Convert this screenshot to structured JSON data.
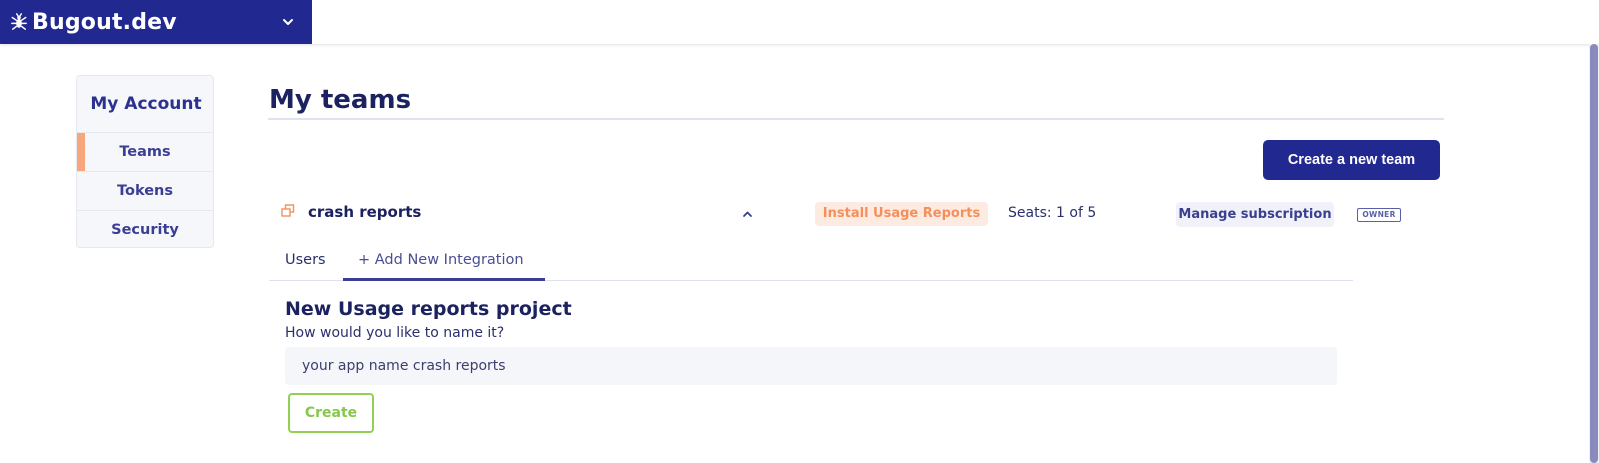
{
  "header": {
    "brand_name": "Bugout.dev",
    "brand_color": "#212990"
  },
  "sidebar": {
    "title": "My Account",
    "items": [
      {
        "label": "Teams",
        "active": true
      },
      {
        "label": "Tokens",
        "active": false
      },
      {
        "label": "Security",
        "active": false
      }
    ]
  },
  "main": {
    "page_title": "My teams",
    "create_team_label": "Create a new team",
    "team": {
      "name": "crash reports",
      "install_label": "Install Usage Reports",
      "seats": "Seats: 1 of 5",
      "manage_label": "Manage subscription",
      "role_badge": "OWNER"
    },
    "tabs": [
      {
        "label": "Users",
        "active": false
      },
      {
        "label": "+ Add New Integration",
        "active": true
      }
    ],
    "form": {
      "title": "New Usage reports project",
      "prompt": "How would you like to name it?",
      "input_placeholder": "your app name crash reports",
      "input_value": "",
      "submit_label": "Create"
    }
  },
  "icons": [
    "bug-icon",
    "chevron-down-icon",
    "team-copy-icon",
    "chevron-up-icon"
  ],
  "colors": {
    "accent_orange": "#f8a77c",
    "accent_green": "#92d150",
    "primary": "#212990"
  }
}
